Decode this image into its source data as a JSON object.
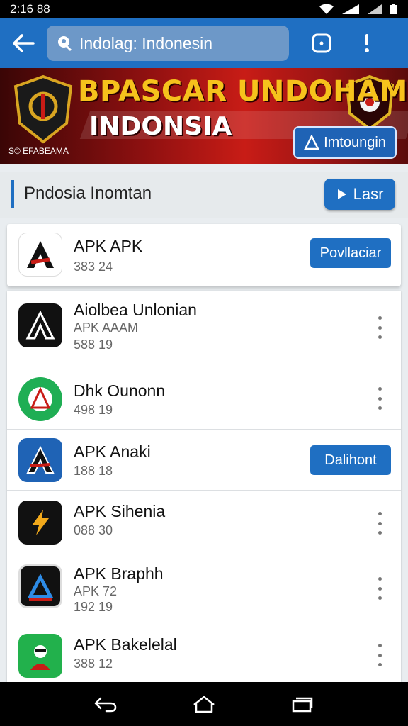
{
  "status_bar": {
    "time": "2:16",
    "extra": "88"
  },
  "app_bar": {
    "search_text": "Indolag: Indonesin"
  },
  "banner": {
    "title": "BPASCAR UNDOHAM",
    "subtitle": "INDONSIA",
    "small_text": "S© EFABEAMA",
    "cta_label": "Imtoungin"
  },
  "section": {
    "title": "Pndosia Inomtan",
    "button_label": "Lasr"
  },
  "featured": {
    "name": "APK APK",
    "meta": "383 24",
    "button_label": "Povllaciar"
  },
  "apps": [
    {
      "name": "Aiolbea Unlonian",
      "meta1": "APK AAAM",
      "meta2": "588 19",
      "action": "menu"
    },
    {
      "name": "Dhk Ounonn",
      "meta1": "498 19",
      "meta2": "",
      "action": "menu"
    },
    {
      "name": "APK Anaki",
      "meta1": "188 18",
      "meta2": "",
      "action": "button",
      "button_label": "Dalihont"
    },
    {
      "name": "APK Sihenia",
      "meta1": "088 30",
      "meta2": "",
      "action": "menu"
    },
    {
      "name": "APK Braphh",
      "meta1": "APK 72",
      "meta2": "192 19",
      "action": "menu"
    },
    {
      "name": "APK Bakelelal",
      "meta1": "388 12",
      "meta2": "",
      "action": "menu"
    }
  ],
  "colors": {
    "primary": "#1f6fc2",
    "banner_red": "#c81c16",
    "banner_gold": "#f6c21c"
  }
}
